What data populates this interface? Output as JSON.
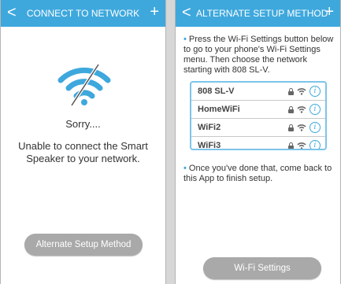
{
  "screen1": {
    "back_glyph": "<",
    "title": "CONNECT TO NETWORK",
    "plus_glyph": "+",
    "sorry_text": "Sorry....",
    "error_text": "Unable to connect the Smart Speaker to your network.",
    "button_label": "Alternate Setup Method",
    "icon": "wifi-off-icon"
  },
  "screen2": {
    "back_glyph": "<",
    "title": "ALTERNATE SETUP METHOD",
    "plus_glyph": "+",
    "instruction_1": "Press the Wi-Fi Settings button below to go to your phone's Wi-Fi Settings menu. Then choose the network starting with 808 SL-V.",
    "networks": [
      {
        "name": "808 SL-V"
      },
      {
        "name": "HomeWiFi"
      },
      {
        "name": "WiFi2"
      },
      {
        "name": "WiFi3"
      }
    ],
    "info_glyph": "i",
    "instruction_2": "Once you've done that, come back to this App to finish setup.",
    "button_label": "Wi-Fi Settings"
  },
  "colors": {
    "accent": "#3ea8dd",
    "button_gray": "#a9a9a9",
    "background": "#d7d7d7"
  }
}
